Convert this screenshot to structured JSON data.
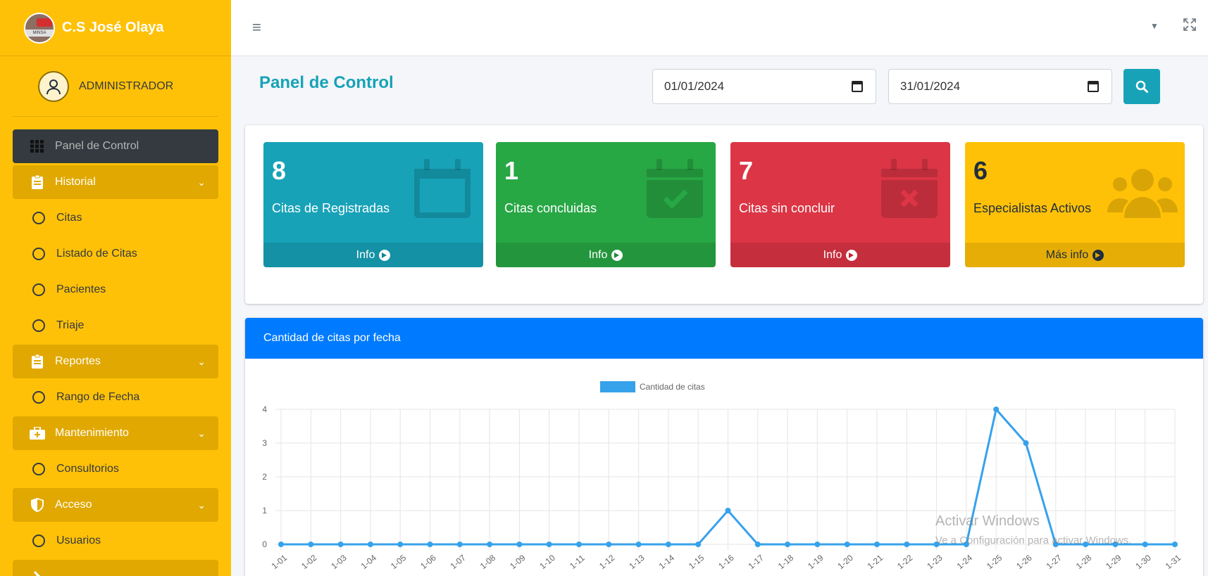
{
  "brand": {
    "name": "C.S José Olaya",
    "logo_text": "MINSA"
  },
  "user": {
    "role": "ADMINISTRADOR"
  },
  "sidebar": {
    "items": [
      {
        "label": "Panel de Control"
      },
      {
        "label": "Historial"
      },
      {
        "label": "Citas"
      },
      {
        "label": "Listado de Citas"
      },
      {
        "label": "Pacientes"
      },
      {
        "label": "Triaje"
      },
      {
        "label": "Reportes"
      },
      {
        "label": "Rango de Fecha"
      },
      {
        "label": "Mantenimiento"
      },
      {
        "label": "Consultorios"
      },
      {
        "label": "Acceso"
      },
      {
        "label": "Usuarios"
      }
    ]
  },
  "topbar": {
    "menu_icon": "hamburger-icon",
    "expand_icon": "expand-icon"
  },
  "header": {
    "title": "Panel de Control",
    "date_from": "01/01/2024",
    "date_to": "31/01/2024"
  },
  "stats": [
    {
      "value": "8",
      "label": "Citas de Registradas",
      "footer": "Info",
      "color": "#17a2b8",
      "icon": "calendar-icon"
    },
    {
      "value": "1",
      "label": "Citas concluidas",
      "footer": "Info",
      "color": "#28a745",
      "icon": "calendar-check-icon"
    },
    {
      "value": "7",
      "label": "Citas sin concluir",
      "footer": "Info",
      "color": "#dc3545",
      "icon": "calendar-times-icon"
    },
    {
      "value": "6",
      "label": "Especialistas Activos",
      "footer": "Más info",
      "color": "#ffc107",
      "icon": "users-icon"
    }
  ],
  "chart_card": {
    "title": "Cantidad de citas por fecha"
  },
  "chart_data": {
    "type": "line",
    "categories": [
      "01-01",
      "01-02",
      "01-03",
      "01-04",
      "01-05",
      "01-06",
      "01-07",
      "01-08",
      "01-09",
      "01-10",
      "01-11",
      "01-12",
      "01-13",
      "01-14",
      "01-15",
      "01-16",
      "01-17",
      "01-18",
      "01-19",
      "01-20",
      "01-21",
      "01-22",
      "01-23",
      "01-24",
      "01-25",
      "01-26",
      "01-27",
      "01-28",
      "01-29",
      "01-30",
      "01-31"
    ],
    "tick_labels": [
      "1-01",
      "1-02",
      "1-03",
      "1-04",
      "1-05",
      "1-06",
      "1-07",
      "1-08",
      "1-09",
      "1-10",
      "1-11",
      "1-12",
      "1-13",
      "1-14",
      "1-15",
      "1-16",
      "1-17",
      "1-18",
      "1-19",
      "1-20",
      "1-21",
      "1-22",
      "1-23",
      "1-24",
      "1-25",
      "1-26",
      "1-27",
      "1-28",
      "1-29",
      "1-30",
      "1-31"
    ],
    "series": [
      {
        "name": "Cantidad de citas",
        "color": "#36a2eb",
        "values": [
          0,
          0,
          0,
          0,
          0,
          0,
          0,
          0,
          0,
          0,
          0,
          0,
          0,
          0,
          0,
          1,
          0,
          0,
          0,
          0,
          0,
          0,
          0,
          0,
          4,
          3,
          0,
          0,
          0,
          0,
          0
        ]
      }
    ],
    "ylim": [
      0,
      4
    ],
    "yticks": [
      0,
      1,
      2,
      3,
      4
    ],
    "grid": true,
    "legend": "top"
  },
  "watermark": {
    "line1": "Activar Windows",
    "line2": "Ve a Configuración para activar Windows."
  }
}
